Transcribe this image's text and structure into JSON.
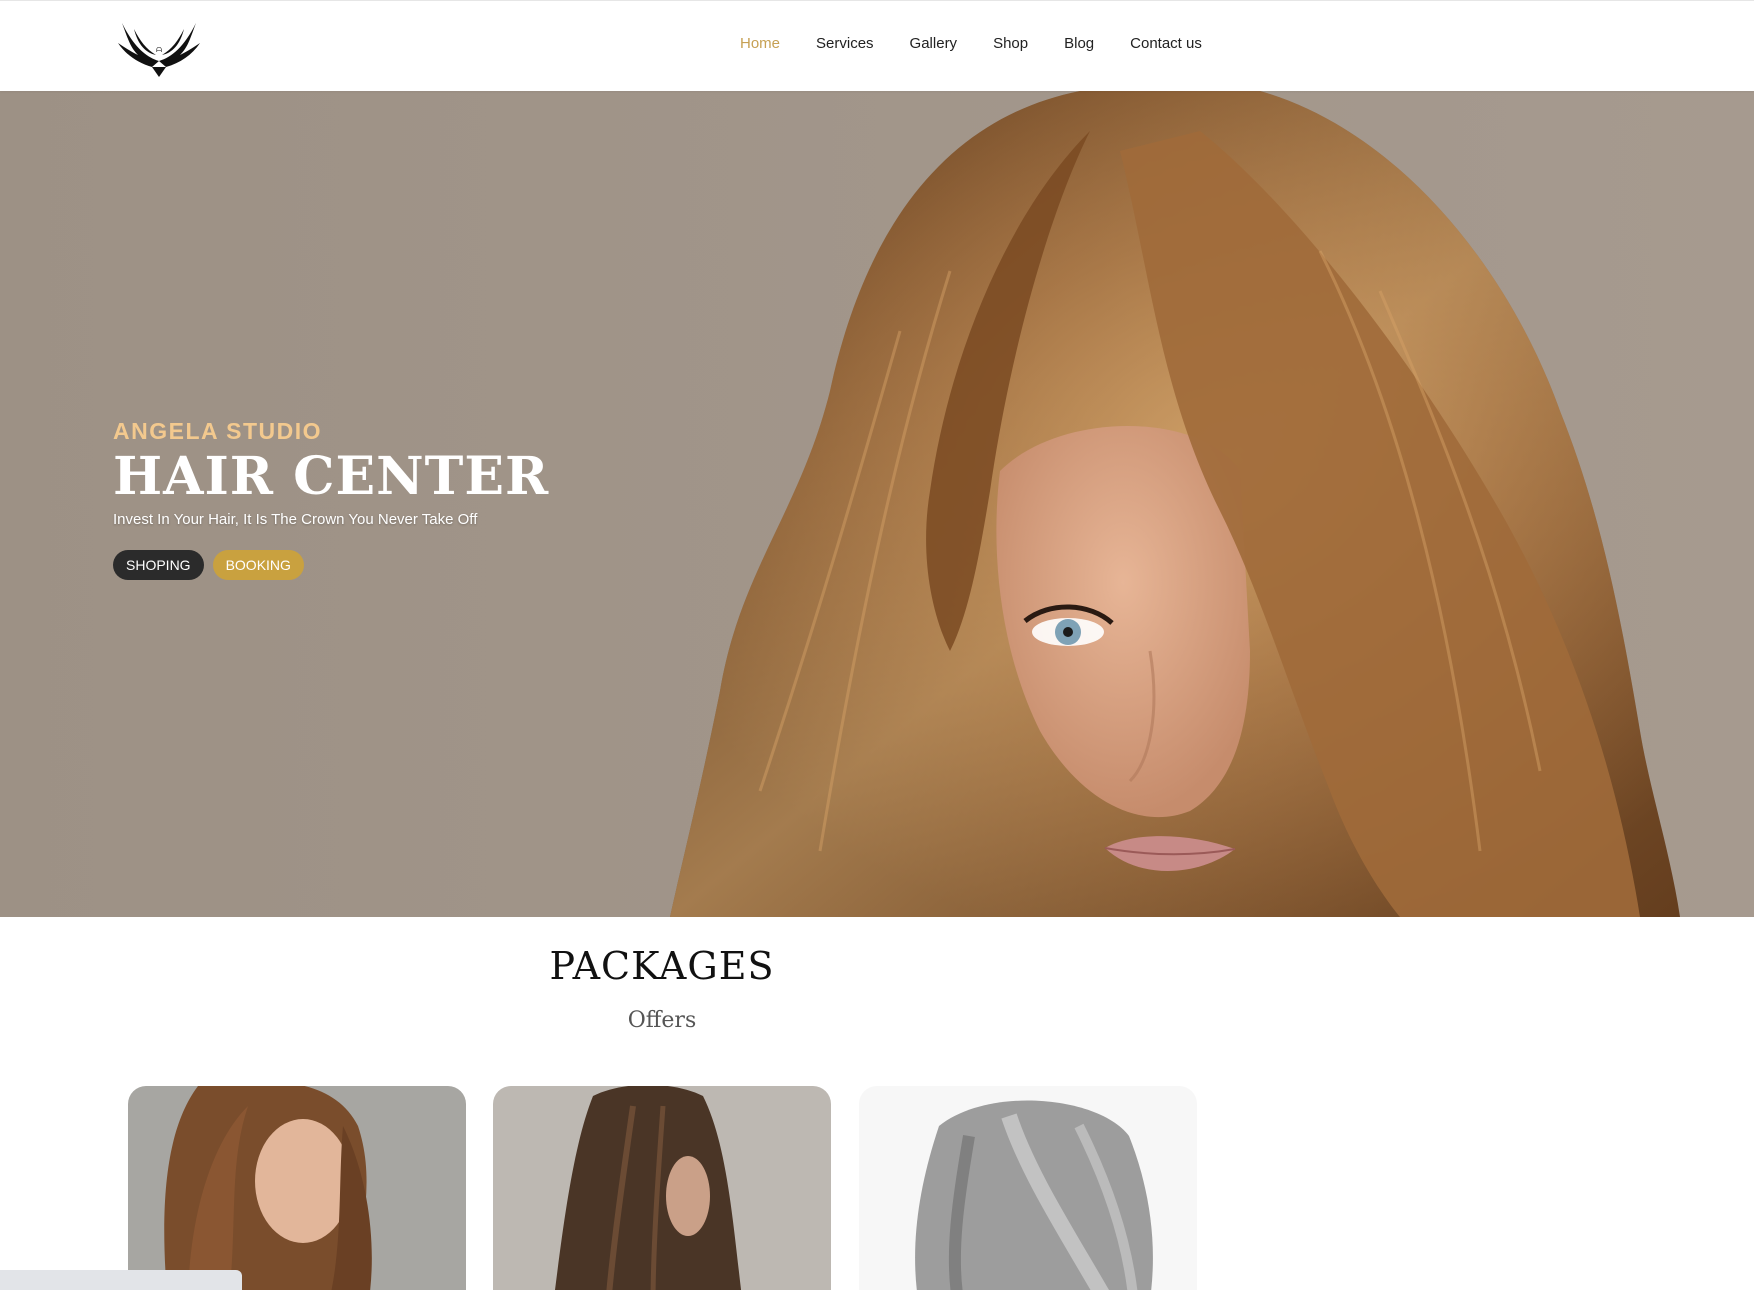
{
  "header": {
    "logo_icon": "winged-logo-icon",
    "nav": [
      {
        "label": "Home",
        "active": true
      },
      {
        "label": "Services",
        "active": false
      },
      {
        "label": "Gallery",
        "active": false
      },
      {
        "label": "Shop",
        "active": false
      },
      {
        "label": "Blog",
        "active": false
      },
      {
        "label": "Contact us",
        "active": false
      }
    ],
    "accent_color": "#c6a053"
  },
  "hero": {
    "eyebrow": "ANGELA STUDIO",
    "title": "HAIR CENTER",
    "tagline": "Invest In Your Hair, It Is The Crown You Never Take Off",
    "buttons": {
      "shopping": "SHOPING",
      "booking": "BOOKING"
    },
    "background_color": "#a09488",
    "eyebrow_color": "#f3c98e",
    "booking_color": "#c9a13f"
  },
  "packages": {
    "title": "PACKAGES",
    "subtitle": "Offers"
  }
}
